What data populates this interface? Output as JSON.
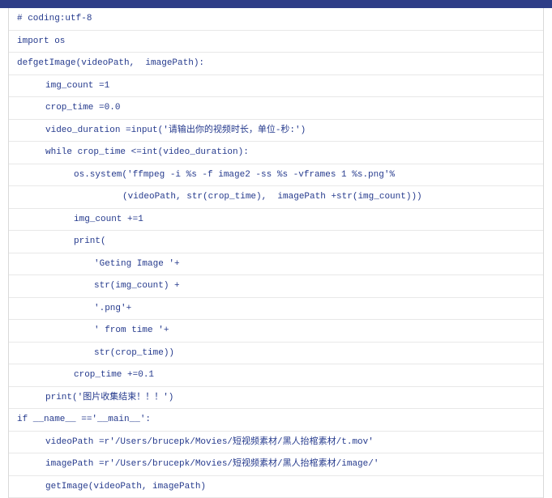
{
  "code": {
    "lines": [
      {
        "text": "# coding:utf-8",
        "indent": 0
      },
      {
        "text": "import os",
        "indent": 0
      },
      {
        "text": "defgetImage(videoPath,  imagePath):",
        "indent": 0
      },
      {
        "text": "img_count =1",
        "indent": 1
      },
      {
        "text": "crop_time =0.0",
        "indent": 1
      },
      {
        "text": "video_duration =input('请输出你的视频时长，单位-秒:')",
        "indent": 1
      },
      {
        "text": "while crop_time <=int(video_duration):",
        "indent": 1
      },
      {
        "text": "os.system('ffmpeg -i %s -f image2 -ss %s -vframes 1 %s.png'%",
        "indent": 2
      },
      {
        "text": "(videoPath, str(crop_time),  imagePath +str(img_count)))",
        "indent": 4
      },
      {
        "text": "img_count +=1",
        "indent": 2
      },
      {
        "text": "print(",
        "indent": 2
      },
      {
        "text": "'Geting Image '+",
        "indent": 3
      },
      {
        "text": "str(img_count) +",
        "indent": 3
      },
      {
        "text": "'.png'+",
        "indent": 3
      },
      {
        "text": "' from time '+",
        "indent": 3
      },
      {
        "text": "str(crop_time))",
        "indent": 3
      },
      {
        "text": "crop_time +=0.1",
        "indent": 2
      },
      {
        "text": "print('图片收集结束！！！')",
        "indent": 1
      },
      {
        "text": "if __name__ =='__main__':",
        "indent": 0
      },
      {
        "text": "videoPath =r'/Users/brucepk/Movies/短视频素材/黑人抬棺素材/t.mov'",
        "indent": 1
      },
      {
        "text": "imagePath =r'/Users/brucepk/Movies/短视频素材/黑人抬棺素材/image/'",
        "indent": 1
      },
      {
        "text": "getImage(videoPath, imagePath)",
        "indent": 1
      }
    ]
  }
}
